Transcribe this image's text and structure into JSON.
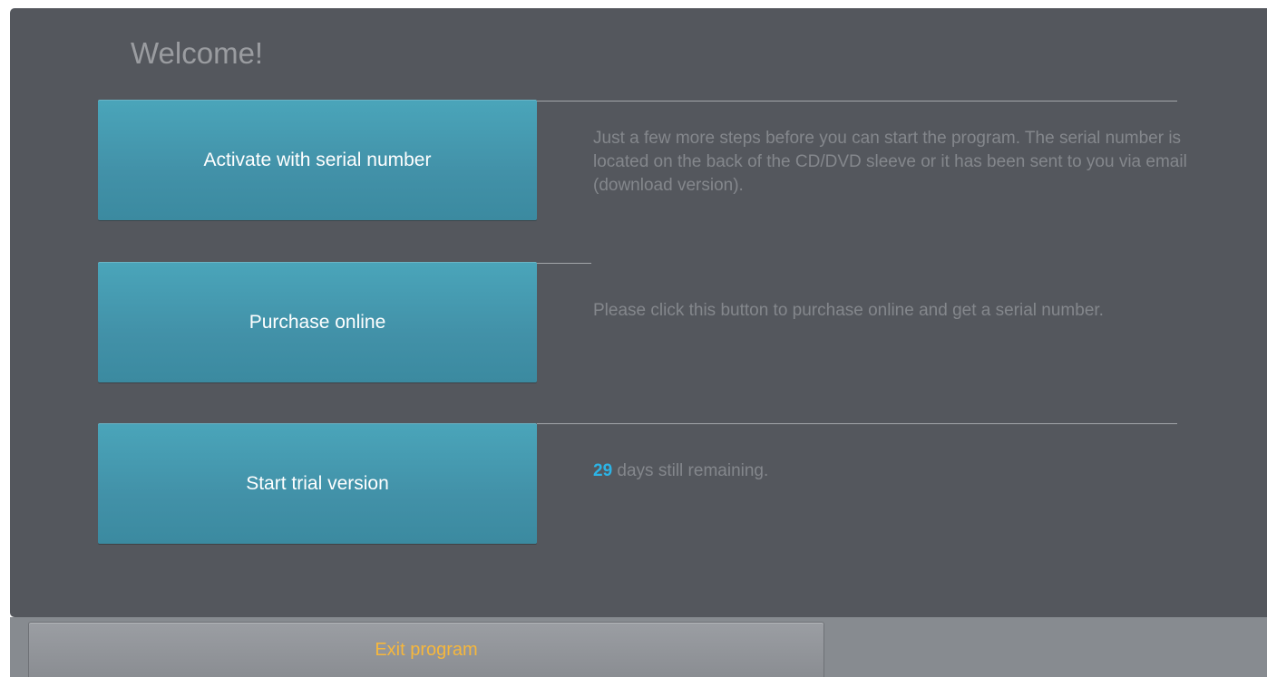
{
  "dialog": {
    "title": "Welcome!"
  },
  "options": [
    {
      "button_label": "Activate with serial number",
      "description": "Just a few more steps before you can start the program. The serial number is located on the back of the CD/DVD sleeve or it has been sent to you via email (download version)."
    },
    {
      "button_label": "Purchase online",
      "description": "Please click this button to purchase online and get a serial number."
    },
    {
      "button_label": "Start trial version",
      "days_remaining": "29",
      "days_suffix": " days still remaining."
    }
  ],
  "footer": {
    "exit_label": "Exit program"
  },
  "colors": {
    "panel_bg": "#54575d",
    "button_accent": "#4a9fb5",
    "days_highlight": "#2cb4e6",
    "exit_text": "#f6b73c"
  }
}
